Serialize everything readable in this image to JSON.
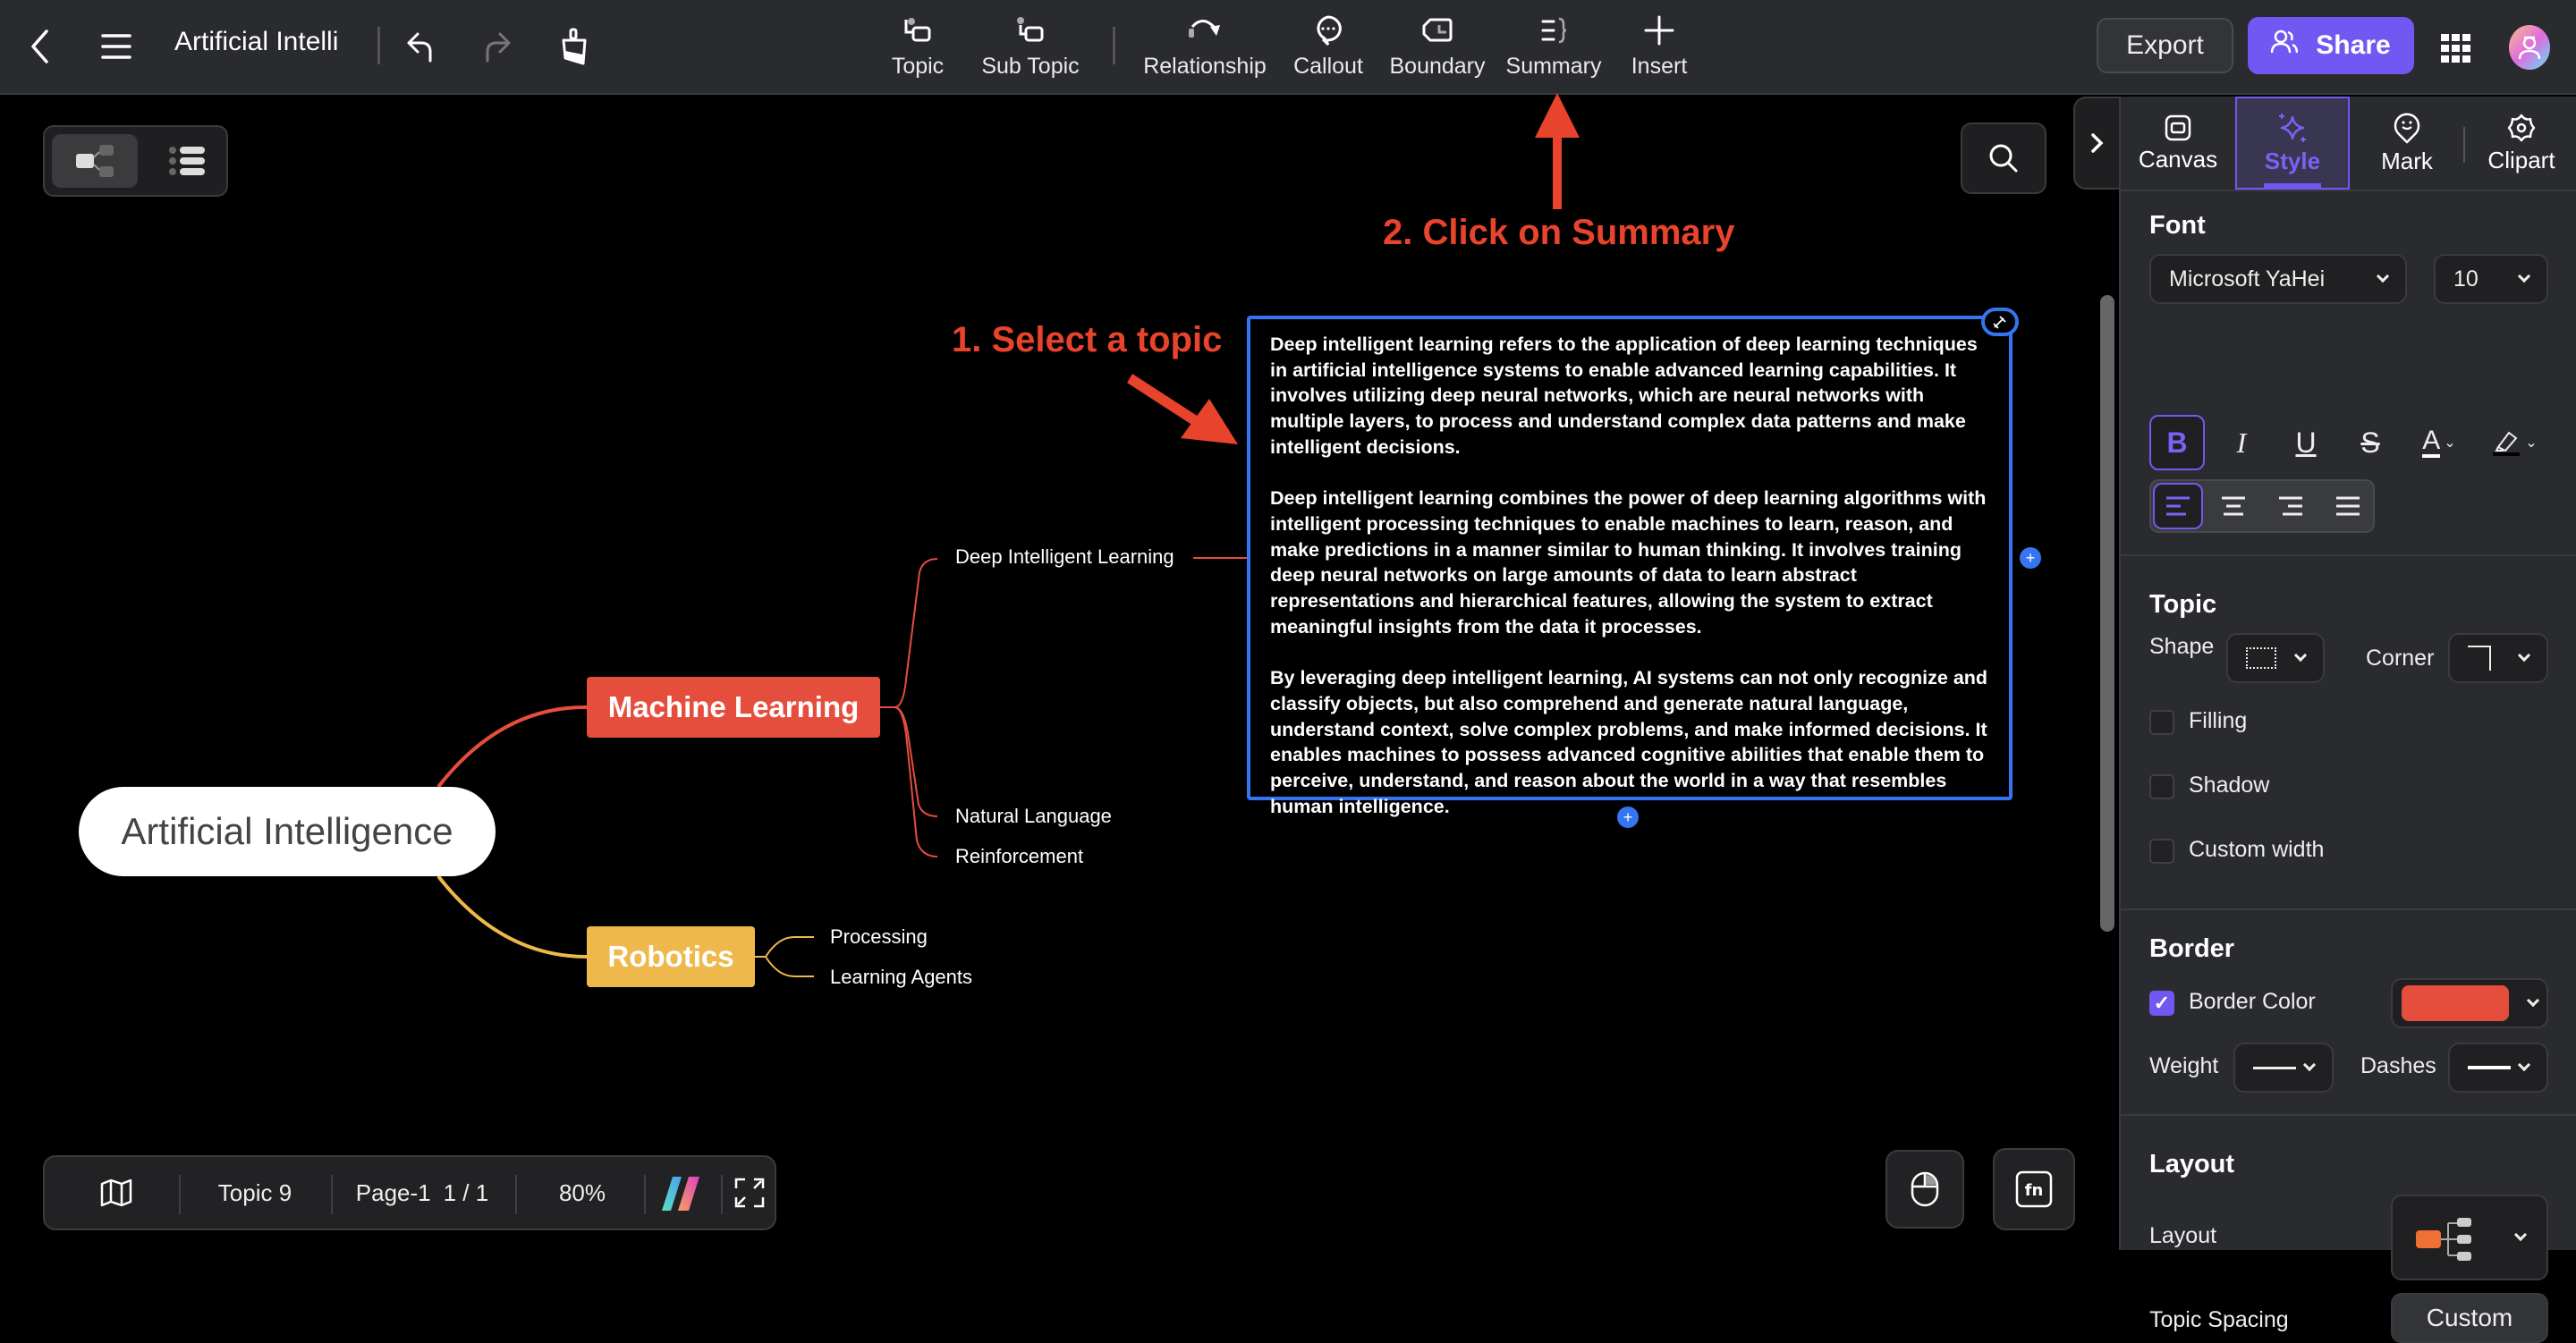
{
  "header": {
    "doc_title": "Artificial Intelli",
    "tools": [
      {
        "id": "topic",
        "label": "Topic",
        "icon": "topic-icon"
      },
      {
        "id": "subtopic",
        "label": "Sub Topic",
        "icon": "subtopic-icon"
      },
      {
        "id": "relationship",
        "label": "Relationship",
        "icon": "relationship-icon"
      },
      {
        "id": "callout",
        "label": "Callout",
        "icon": "callout-icon"
      },
      {
        "id": "boundary",
        "label": "Boundary",
        "icon": "boundary-icon"
      },
      {
        "id": "summary",
        "label": "Summary",
        "icon": "summary-icon"
      },
      {
        "id": "insert",
        "label": "Insert",
        "icon": "plus-icon"
      }
    ],
    "export_label": "Export",
    "share_label": "Share",
    "accent_color": "#7258f2"
  },
  "annotations": {
    "step1": "1. Select a topic",
    "step2": "2. Click on Summary",
    "color": "#e8432c"
  },
  "mindmap": {
    "root": "Artificial Intelligence",
    "branches": [
      {
        "label": "Machine Learning",
        "color": "#e54e3d",
        "children": [
          "Deep Intelligent Learning",
          "Natural Language",
          "Reinforcement"
        ]
      },
      {
        "label": "Robotics",
        "color": "#eeb84a",
        "children": [
          "Processing",
          "Learning Agents"
        ]
      }
    ],
    "selected_topic_paragraphs": [
      "Deep intelligent learning refers to the application of deep learning techniques in artificial intelligence systems to enable advanced learning capabilities. It involves utilizing deep neural networks, which are neural networks with multiple layers, to process and understand complex data patterns and make intelligent decisions.",
      "Deep intelligent learning combines the power of deep learning algorithms with intelligent processing techniques to enable machines to learn, reason, and make predictions in a manner similar to human thinking. It involves training deep neural networks on large amounts of data to learn abstract representations and hierarchical features, allowing the system to extract meaningful insights from the data it processes.",
      "By leveraging deep intelligent learning, AI systems can not only recognize and classify objects, but also comprehend and generate natural language, understand context, solve complex problems, and make informed decisions. It enables machines to possess advanced cognitive abilities that enable them to perceive, understand, and reason about the world in a way that resembles human intelligence."
    ]
  },
  "status_bar": {
    "topic_count": "Topic 9",
    "page_label": "Page-1",
    "page_index": "1 / 1",
    "zoom": "80%"
  },
  "panel": {
    "tabs": [
      {
        "label": "Canvas",
        "icon": "canvas-icon"
      },
      {
        "label": "Style",
        "icon": "sparkle-icon",
        "active": true
      },
      {
        "label": "Mark",
        "icon": "mark-icon"
      },
      {
        "label": "Clipart",
        "icon": "clipart-icon"
      }
    ],
    "font": {
      "title": "Font",
      "family": "Microsoft YaHei",
      "size": "10",
      "bold": true,
      "alignment": "left"
    },
    "topic": {
      "title": "Topic",
      "shape_label": "Shape",
      "corner_label": "Corner",
      "filling_label": "Filling",
      "filling": false,
      "shadow_label": "Shadow",
      "shadow": false,
      "custom_width_label": "Custom width",
      "custom_width": false
    },
    "border": {
      "title": "Border",
      "border_color_label": "Border Color",
      "border_color_enabled": true,
      "border_color": "#e54e3d",
      "weight_label": "Weight",
      "dashes_label": "Dashes"
    },
    "layout": {
      "title": "Layout",
      "layout_label": "Layout",
      "topic_spacing_label": "Topic Spacing",
      "topic_spacing_value": "Custom"
    }
  }
}
